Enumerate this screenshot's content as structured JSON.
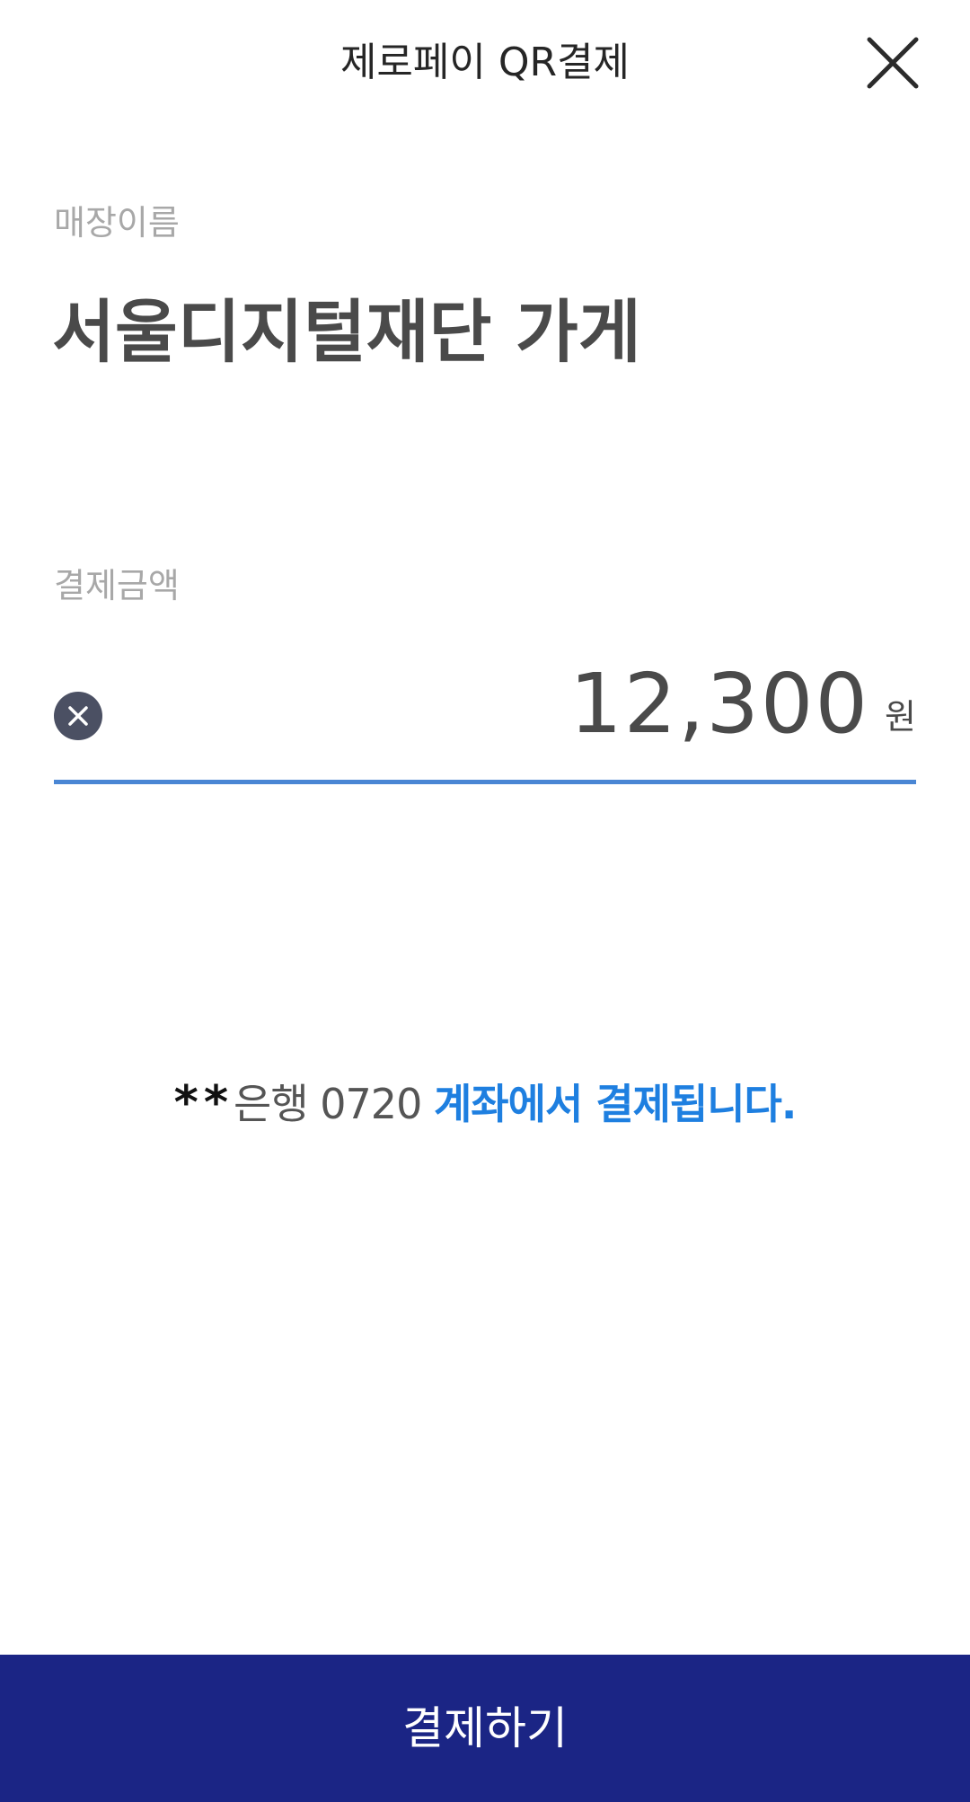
{
  "header": {
    "title": "제로페이 QR결제",
    "close_icon": "close-icon"
  },
  "store": {
    "label": "매장이름",
    "name": "서울디지털재단 가게"
  },
  "amount": {
    "label": "결제금액",
    "value": "12,300",
    "unit": "원",
    "clear_icon": "clear-icon"
  },
  "account": {
    "masked": "**",
    "bank_number": "은행 0720",
    "message": "계좌에서 결제됩니다."
  },
  "pay_button": {
    "label": "결제하기"
  },
  "colors": {
    "accent_blue": "#1e7fe0",
    "underline": "#4a86d4",
    "button_bg": "#1b2585"
  }
}
